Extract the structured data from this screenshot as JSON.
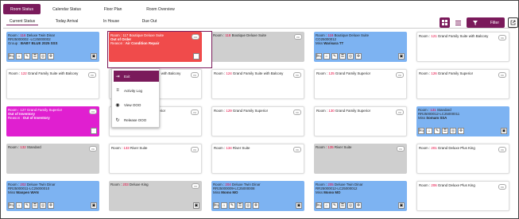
{
  "top_tabs": [
    "Room Status",
    "Calendar Status",
    "Floor Plan",
    "Room Overview"
  ],
  "sub_tabs": [
    "Current Status",
    "Today Arrival",
    "In House",
    "Due Out"
  ],
  "filter_label": "Filter",
  "menu": {
    "items": [
      "Exit",
      "Activity Log",
      "View OOO",
      "Release OOO"
    ]
  },
  "rooms": [
    {
      "prefix": "Room : ",
      "num": "116",
      "suffix": " Deluxe Twin Dinar",
      "line2": "RR25000002 -LC25000002",
      "l3a": "Group : ",
      "l3b": "BABY BLUE 2025 SSS",
      "badge": "",
      "color": "blue"
    },
    {
      "prefix": "Room : ",
      "num": "117",
      "suffix": " Boutique Deluxe Suite",
      "line2": "Out of Order",
      "l3a": "Reason : ",
      "l3b": "Air Condition Repair",
      "badge": "OO",
      "color": "red"
    },
    {
      "prefix": "Room : ",
      "num": "118",
      "suffix": " Boutique Deluxe Suite",
      "line2": "",
      "l3a": "",
      "l3b": "",
      "badge": "VC",
      "color": "grey"
    },
    {
      "prefix": "Room : ",
      "num": "119",
      "suffix": " Boutique Deluxe Suite",
      "line2": "CO25000012",
      "l3a": "Miss ",
      "l3b": "Warisara TT",
      "badge": "",
      "color": "blue"
    },
    {
      "prefix": "Room : ",
      "num": "121",
      "suffix": " Grand Family Suite with Balcony",
      "line2": "",
      "l3a": "",
      "l3b": "",
      "badge": "VC",
      "color": "white"
    },
    {
      "prefix": "Room : ",
      "num": "122",
      "suffix": " Grand Family Suite with Balcony",
      "line2": "",
      "l3a": "",
      "l3b": "",
      "badge": "VC",
      "color": "white"
    },
    {
      "prefix": "Room : ",
      "num": "123",
      "suffix": " Grand Family Suite with Balcony",
      "line2": "",
      "l3a": "",
      "l3b": "",
      "badge": "VC",
      "color": "white"
    },
    {
      "prefix": "Room : ",
      "num": "124",
      "suffix": " Grand Family Suite with Balcony",
      "line2": "",
      "l3a": "",
      "l3b": "",
      "badge": "VC",
      "color": "white"
    },
    {
      "prefix": "Room : ",
      "num": "125",
      "suffix": " Grand Family Superior",
      "line2": "",
      "l3a": "",
      "l3b": "",
      "badge": "VC",
      "color": "white"
    },
    {
      "prefix": "Room : ",
      "num": "126",
      "suffix": " Grand Family Superior",
      "line2": "",
      "l3a": "",
      "l3b": "",
      "badge": "VC",
      "color": "white"
    },
    {
      "prefix": "Room : ",
      "num": "127",
      "suffix": " Grand Family Superior",
      "line2": "Out of Inventory",
      "l3a": "Reason : ",
      "l3b": "Out of Inventory",
      "badge": "OO",
      "color": "magenta"
    },
    {
      "prefix": "Room : ",
      "num": "128",
      "suffix": " Grand Family Superior",
      "line2": "",
      "l3a": "",
      "l3b": "",
      "badge": "VC",
      "color": "white"
    },
    {
      "prefix": "Room : ",
      "num": "129",
      "suffix": " Grand Family Superior",
      "line2": "",
      "l3a": "",
      "l3b": "",
      "badge": "VC",
      "color": "white"
    },
    {
      "prefix": "Room : ",
      "num": "130",
      "suffix": " Grand Family Superior",
      "line2": "",
      "l3a": "",
      "l3b": "",
      "badge": "VC",
      "color": "white"
    },
    {
      "prefix": "Room : ",
      "num": "131",
      "suffix": " Standard",
      "line2": "RR25000012-LC25000011",
      "l3a": "Miss ",
      "l3b": "Somam SSA",
      "badge": "",
      "color": "blue"
    },
    {
      "prefix": "Room : ",
      "num": "132",
      "suffix": " Standard",
      "line2": "",
      "l3a": "",
      "l3b": "",
      "badge": "VC",
      "color": "grey"
    },
    {
      "prefix": "Room : ",
      "num": "133",
      "suffix": " River Suite",
      "line2": "",
      "l3a": "",
      "l3b": "",
      "badge": "VC",
      "color": "white"
    },
    {
      "prefix": "Room : ",
      "num": "134",
      "suffix": " River Suite",
      "line2": "",
      "l3a": "",
      "l3b": "",
      "badge": "VC",
      "color": "white"
    },
    {
      "prefix": "Room : ",
      "num": "135",
      "suffix": " River Suite",
      "line2": "",
      "l3a": "",
      "l3b": "",
      "badge": "VC",
      "color": "grey"
    },
    {
      "prefix": "Room : ",
      "num": "201",
      "suffix": " Grand Deluxe Plus King",
      "line2": "",
      "l3a": "",
      "l3b": "",
      "badge": "VC",
      "color": "white"
    },
    {
      "prefix": "Room : ",
      "num": "202",
      "suffix": " Deluxe Twin Dinar",
      "line2": "RR25000011-LC25000010",
      "l3a": "Miss ",
      "l3b": "Wanpen WAN",
      "badge": "",
      "color": "blue"
    },
    {
      "prefix": "Room : ",
      "num": "203",
      "suffix": " Deluxe King",
      "line2": "",
      "l3a": "",
      "l3b": "",
      "badge": "VC",
      "color": "grey"
    },
    {
      "prefix": "Room : ",
      "num": "204",
      "suffix": " Deluxe Twin Dinar",
      "line2": "RR25000009-LC25000008",
      "l3a": "Miss ",
      "l3b": "Momo MO",
      "badge": "",
      "color": "blue"
    },
    {
      "prefix": "Room : ",
      "num": "205",
      "suffix": " Deluxe Twin Dinar",
      "line2": "RR25000012-LC25000012",
      "l3a": "Miss ",
      "l3b": "Momo MO",
      "badge": "",
      "color": "blue"
    },
    {
      "prefix": "Room : ",
      "num": "206",
      "suffix": " Grand Deluxe Plus King",
      "line2": "",
      "l3a": "",
      "l3b": "",
      "badge": "VC",
      "color": "white"
    }
  ]
}
